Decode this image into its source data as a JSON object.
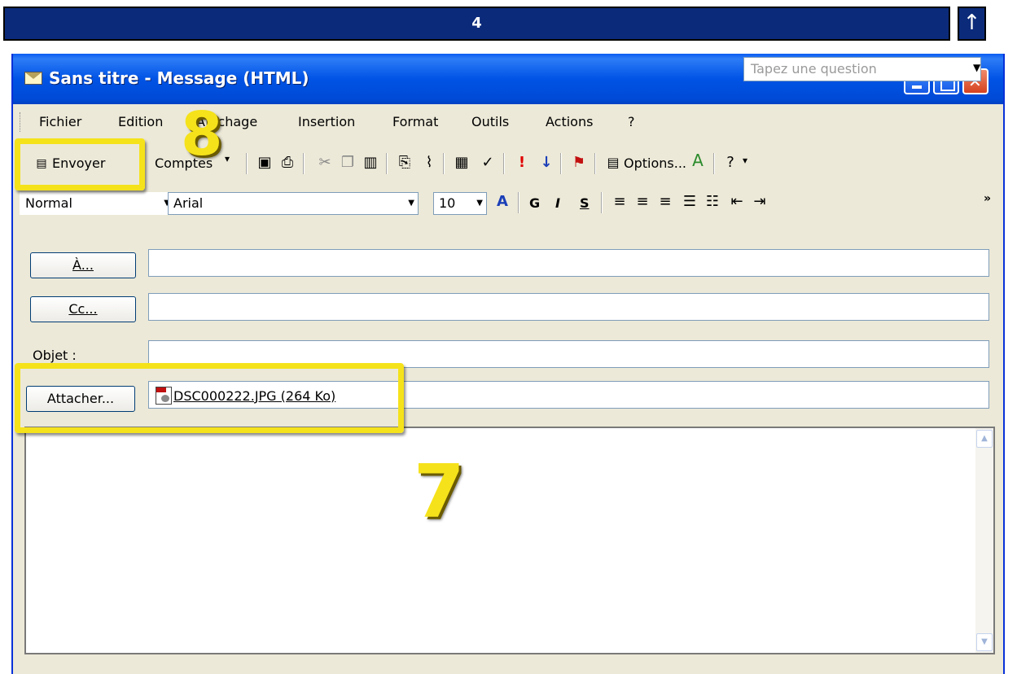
{
  "step_bar": {
    "number": "4",
    "up_arrow_icon": "arrow-up-icon"
  },
  "window": {
    "title": "Sans titre - Message (HTML)",
    "controls": {
      "minimize": "minimize-icon",
      "maximize": "maximize-icon",
      "close": "close-icon"
    }
  },
  "menu": {
    "items": [
      {
        "label": "Fichier"
      },
      {
        "label": "Edition"
      },
      {
        "label": "Affichage"
      },
      {
        "label": "Insertion"
      },
      {
        "label": "Format"
      },
      {
        "label": "Outils"
      },
      {
        "label": "Actions"
      },
      {
        "label": "?"
      }
    ],
    "question_placeholder": "Tapez une question"
  },
  "toolbar": {
    "send_label": "Envoyer",
    "accounts_label": "Comptes",
    "options_label": "Options..."
  },
  "format_toolbar": {
    "style": "Normal",
    "font": "Arial",
    "size": "10",
    "bold": "G",
    "italic": "I",
    "underline": "S"
  },
  "form": {
    "to_button": "À...",
    "cc_button": "Cc...",
    "subject_label": "Objet :",
    "attach_button": "Attacher...",
    "to_value": "",
    "cc_value": "",
    "subject_value": "",
    "attachment": "DSC000222.JPG (264 Ko)"
  },
  "annotations": {
    "send_step": "8",
    "attach_step": "7",
    "highlight_color": "#f5e21a"
  }
}
